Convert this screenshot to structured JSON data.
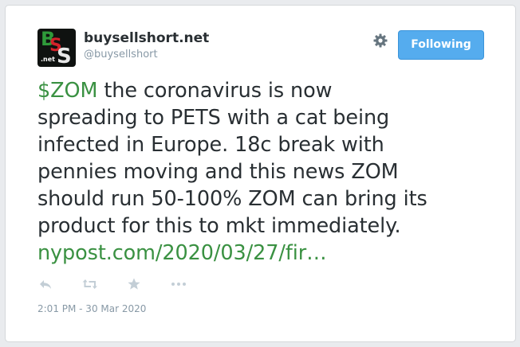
{
  "user": {
    "display_name": "buysellshort.net",
    "screen_name": "@buysellshort",
    "avatar_text": ".net"
  },
  "follow_button": {
    "label": "Following"
  },
  "tweet": {
    "cashtag": "$ZOM",
    "lines": [
      " the coronavirus is now",
      "spreading to PETS with a cat being",
      "infected in Europe. 18c break with",
      "pennies moving and this news ZOM",
      "should run 50-100% ZOM can bring its",
      "product for this to mkt immediately."
    ],
    "link_text": "nypost.com/2020/03/27/fir…"
  },
  "actions": {
    "icons": [
      "reply-icon",
      "retweet-icon",
      "favorite-icon",
      "more-icon"
    ]
  },
  "timestamp": "2:01 PM - 30 Mar 2020",
  "colors": {
    "link": "#3a9142",
    "follow_button": "#55acee",
    "text": "#292f33",
    "muted": "#8899a6"
  }
}
